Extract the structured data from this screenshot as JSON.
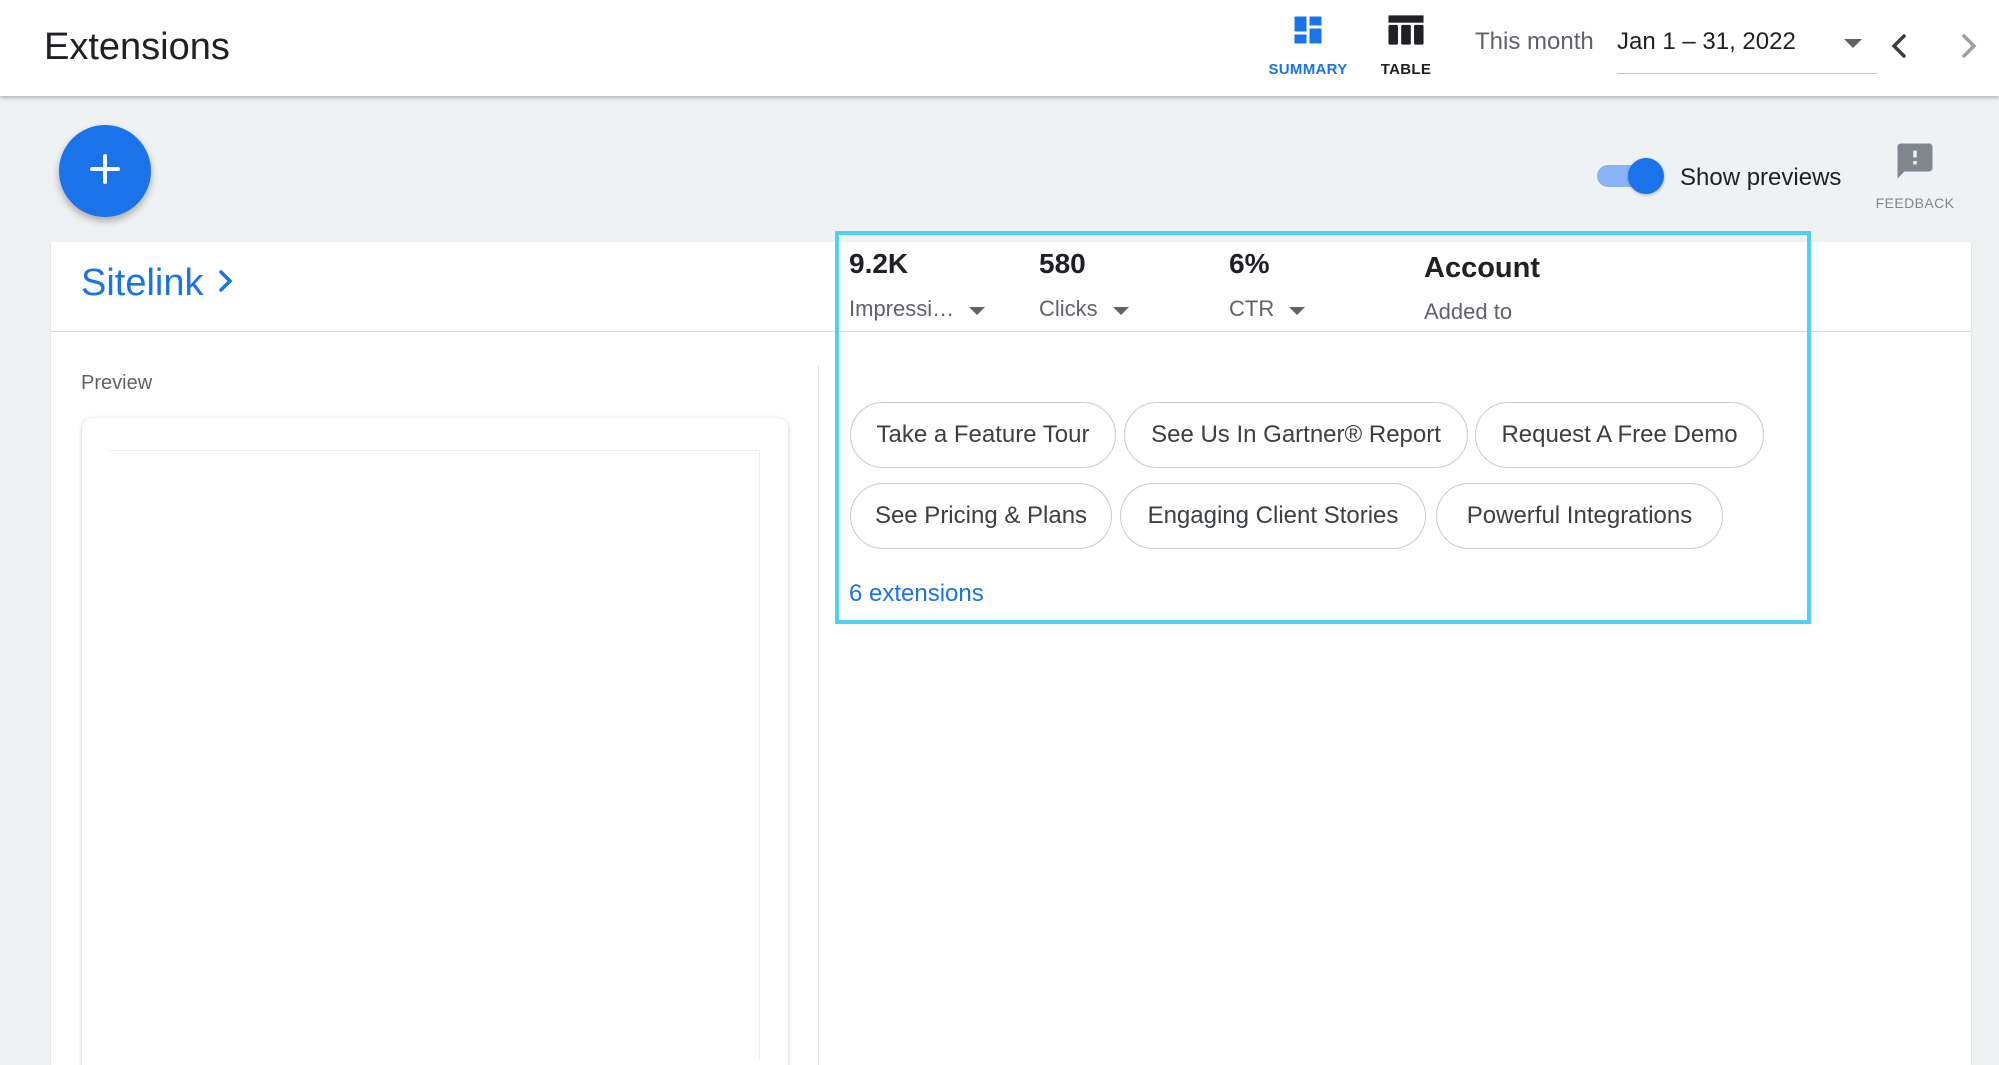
{
  "header": {
    "title": "Extensions",
    "views": [
      {
        "label": "SUMMARY",
        "icon": "dashboard-icon",
        "active": true,
        "color": "#1a73e8"
      },
      {
        "label": "TABLE",
        "icon": "table-icon",
        "active": false
      }
    ],
    "date_caption": "This month",
    "date_range": "Jan 1 – 31, 2022"
  },
  "toolbar": {
    "add_icon": "plus-icon",
    "toggle_label": "Show previews",
    "toggle_on": true,
    "feedback_label": "FEEDBACK"
  },
  "card": {
    "title": "Sitelink",
    "metrics": [
      {
        "value": "9.2K",
        "label": "Impressi…",
        "has_dropdown": true
      },
      {
        "value": "580",
        "label": "Clicks",
        "has_dropdown": true
      },
      {
        "value": "6%",
        "label": "CTR",
        "has_dropdown": true
      },
      {
        "value": "Account",
        "label": "Added to",
        "has_dropdown": false
      }
    ],
    "preview_label": "Preview",
    "sitelinks": [
      "Take a Feature Tour",
      "See Us In Gartner® Report",
      "Request A Free Demo",
      "See Pricing & Plans",
      "Engaging Client Stories",
      "Powerful Integrations"
    ],
    "extensions_link": "6 extensions"
  },
  "colors": {
    "accent": "#1a73e8",
    "highlight": "#4fd2ef",
    "background": "#eff2f3"
  }
}
